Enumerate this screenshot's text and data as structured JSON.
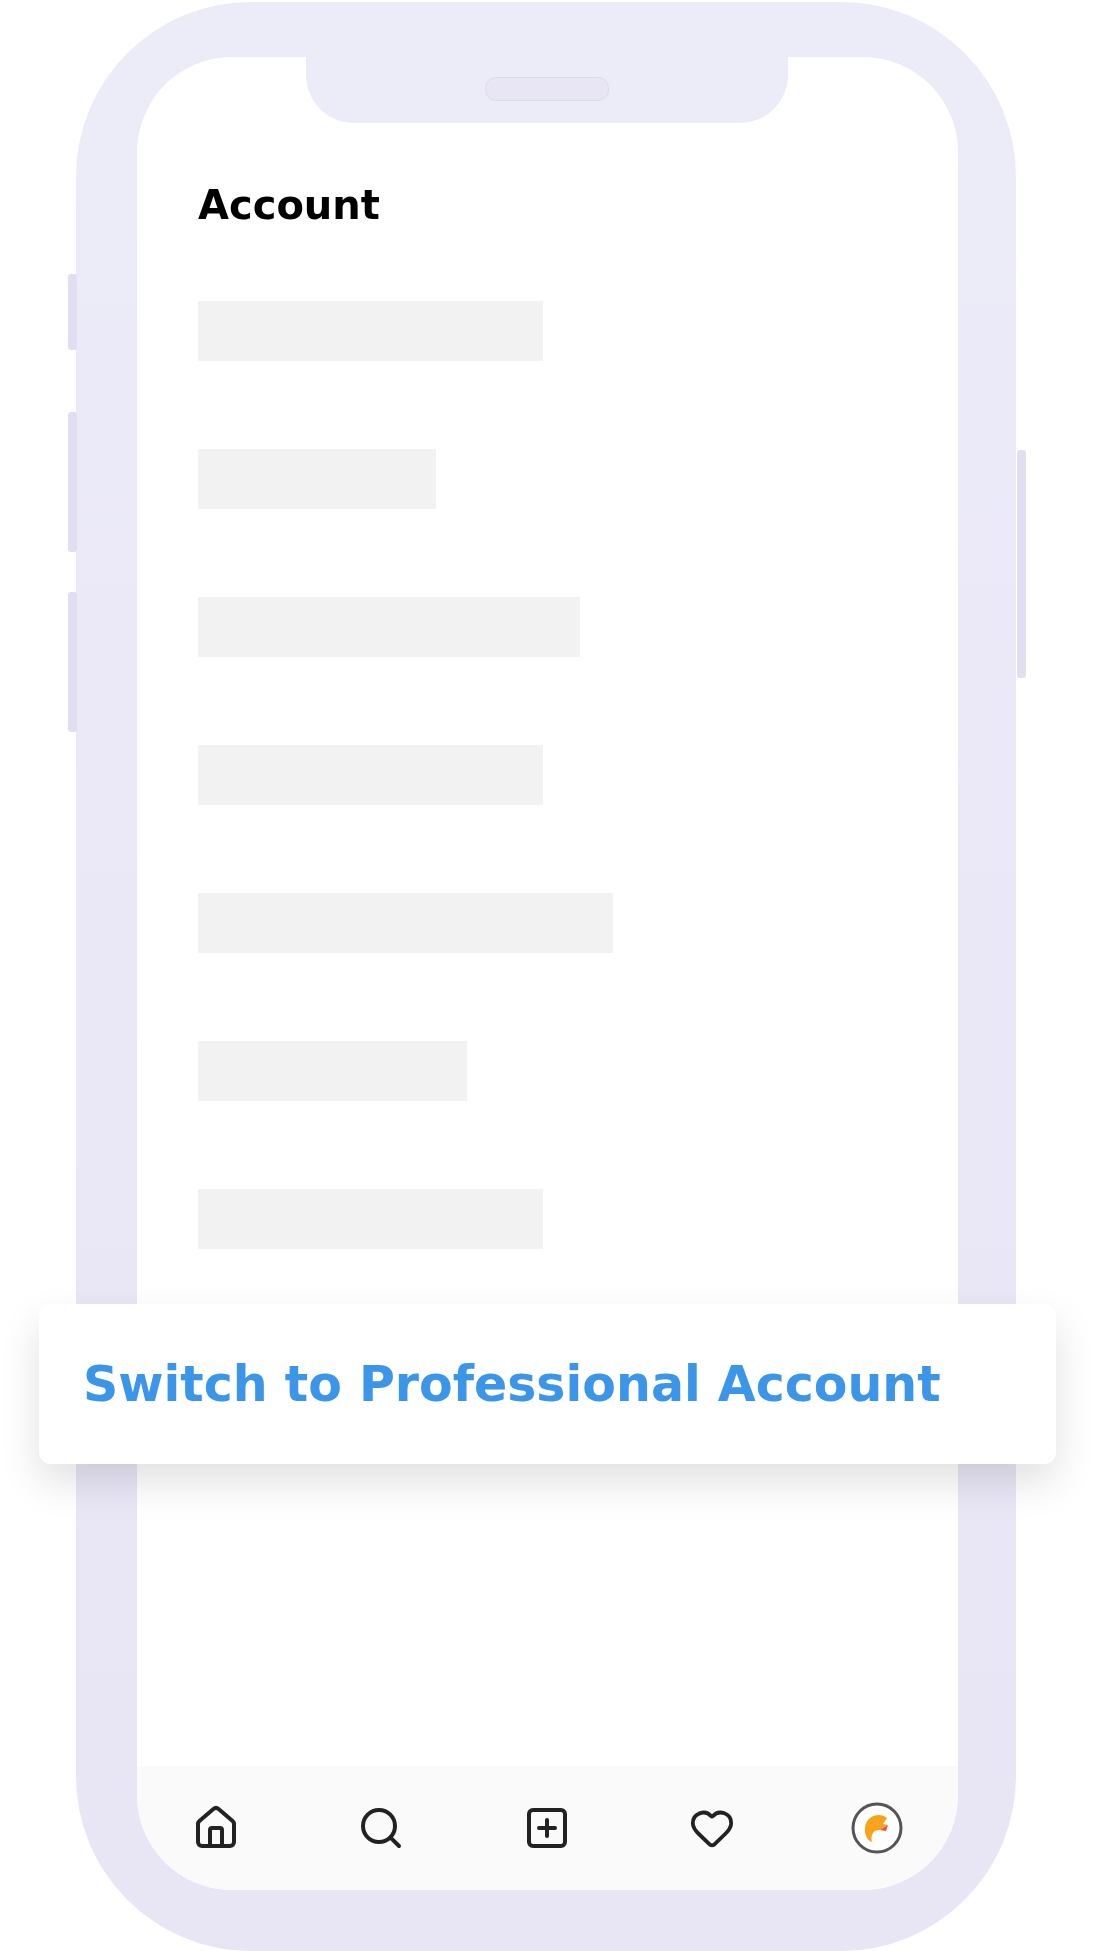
{
  "screen": {
    "title": "Account",
    "rows": [
      {
        "kind": "skeleton"
      },
      {
        "kind": "skeleton"
      },
      {
        "kind": "skeleton"
      },
      {
        "kind": "skeleton"
      },
      {
        "kind": "skeleton"
      },
      {
        "kind": "skeleton"
      },
      {
        "kind": "skeleton"
      }
    ],
    "action_card": {
      "label": "Switch to Professional Account"
    },
    "tab_bar": [
      {
        "kind": "home"
      },
      {
        "kind": "search"
      },
      {
        "kind": "add"
      },
      {
        "kind": "heart"
      },
      {
        "kind": "profile"
      }
    ]
  }
}
